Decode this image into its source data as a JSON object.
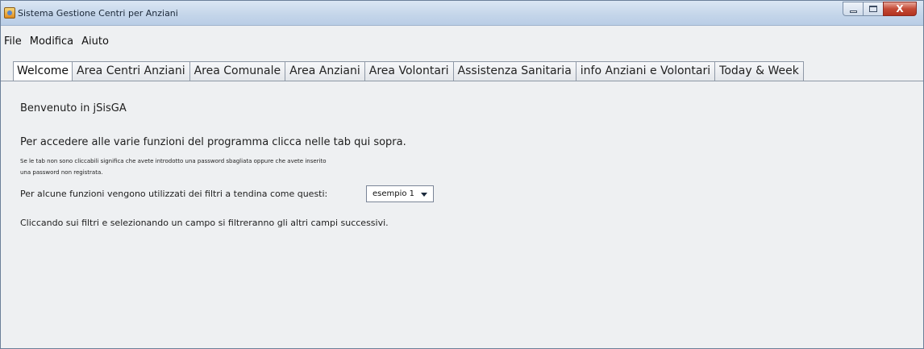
{
  "window": {
    "title": "Sistema Gestione Centri per Anziani",
    "close_label": "X"
  },
  "menubar": {
    "items": [
      "File",
      "Modifica",
      "Aiuto"
    ]
  },
  "tabs": [
    {
      "label": "Welcome",
      "active": true
    },
    {
      "label": "Area Centri Anziani",
      "active": false
    },
    {
      "label": "Area Comunale",
      "active": false
    },
    {
      "label": "Area Anziani",
      "active": false
    },
    {
      "label": "Area Volontari",
      "active": false
    },
    {
      "label": "Assistenza Sanitaria",
      "active": false
    },
    {
      "label": "info Anziani e Volontari",
      "active": false
    },
    {
      "label": "Today & Week",
      "active": false
    }
  ],
  "welcome": {
    "greeting": "Benvenuto in jSisGA",
    "instructions": "Per accedere alle varie funzioni del programma clicca nelle tab qui sopra.",
    "note_line1": "Se le tab non sono cliccabili significa che avete introdotto una password sbagliata oppure che avete inserito",
    "note_line2": "una password non registrata.",
    "filters_text": "Per alcune funzioni vengono utilizzati dei filtri a tendina come questi:",
    "filter_value": "esempio 1",
    "filter_hint": "Cliccando sui filtri e selezionando un campo si filtreranno gli altri campi successivi."
  }
}
